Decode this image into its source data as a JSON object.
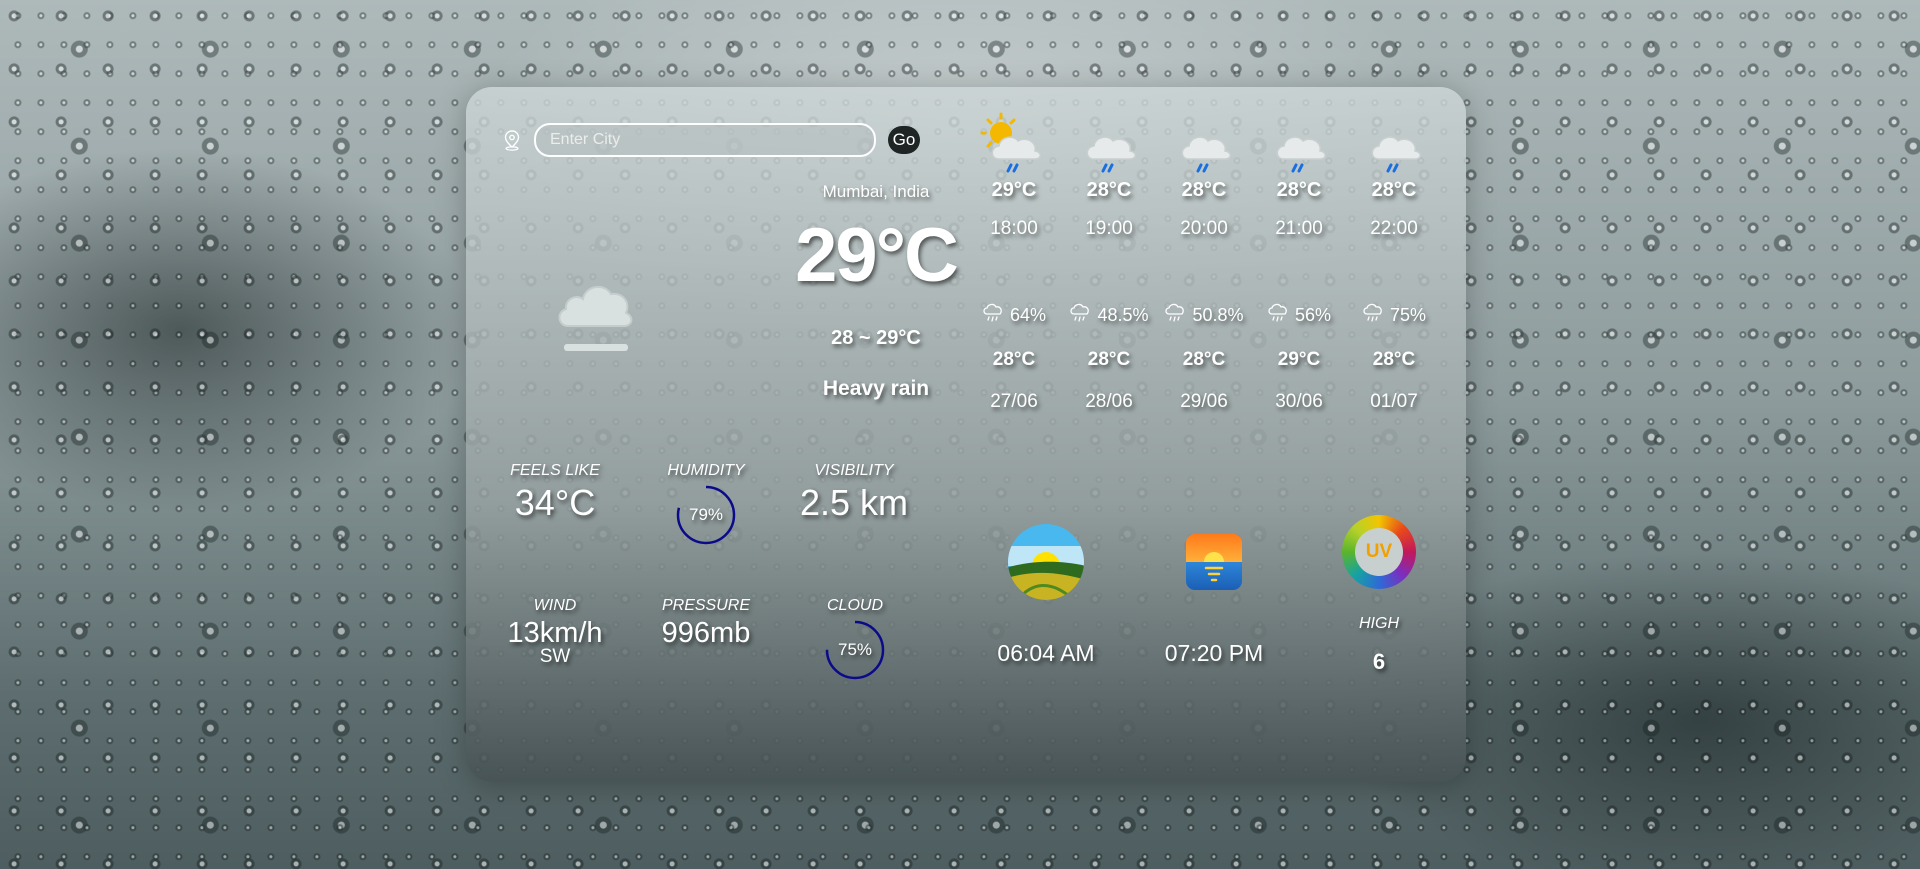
{
  "search": {
    "placeholder": "Enter City",
    "go_label": "Go"
  },
  "current": {
    "location": "Mumbai, India",
    "temperature": "29°C",
    "range": "28 ~ 29°C",
    "condition": "Heavy rain",
    "icon": "cloud-fog-icon"
  },
  "stats": {
    "feels_like": {
      "label": "FEELS LIKE",
      "value": "34°C"
    },
    "humidity": {
      "label": "HUMIDITY",
      "value": "79%",
      "percent": 79
    },
    "visibility": {
      "label": "VISIBILITY",
      "value": "2.5 km"
    },
    "wind": {
      "label": "WIND",
      "value": "13km/h",
      "direction": "SW"
    },
    "pressure": {
      "label": "PRESSURE",
      "value": "996mb"
    },
    "cloud": {
      "label": "CLOUD",
      "value": "75%",
      "percent": 75
    }
  },
  "hourly": [
    {
      "time": "18:00",
      "temp": "29°C",
      "icon": "sun-cloud-rain-icon"
    },
    {
      "time": "19:00",
      "temp": "28°C",
      "icon": "moon-cloud-rain-icon"
    },
    {
      "time": "20:00",
      "temp": "28°C",
      "icon": "moon-cloud-rain-icon"
    },
    {
      "time": "21:00",
      "temp": "28°C",
      "icon": "moon-cloud-rain-icon"
    },
    {
      "time": "22:00",
      "temp": "28°C",
      "icon": "moon-cloud-rain-icon"
    }
  ],
  "daily": [
    {
      "chance": "64%",
      "temp": "28°C",
      "date": "27/06"
    },
    {
      "chance": "48.5%",
      "temp": "28°C",
      "date": "28/06"
    },
    {
      "chance": "50.8%",
      "temp": "28°C",
      "date": "29/06"
    },
    {
      "chance": "56%",
      "temp": "29°C",
      "date": "30/06"
    },
    {
      "chance": "75%",
      "temp": "28°C",
      "date": "01/07"
    }
  ],
  "sun": {
    "sunrise": "06:04 AM",
    "sunset": "07:20 PM"
  },
  "uv": {
    "badge": "UV",
    "level": "HIGH",
    "value": "6"
  },
  "colors": {
    "ring": "#0a0a8a",
    "moon": "#1a5be0",
    "rain": "#1a6fe0",
    "sun": "#f5b800"
  }
}
